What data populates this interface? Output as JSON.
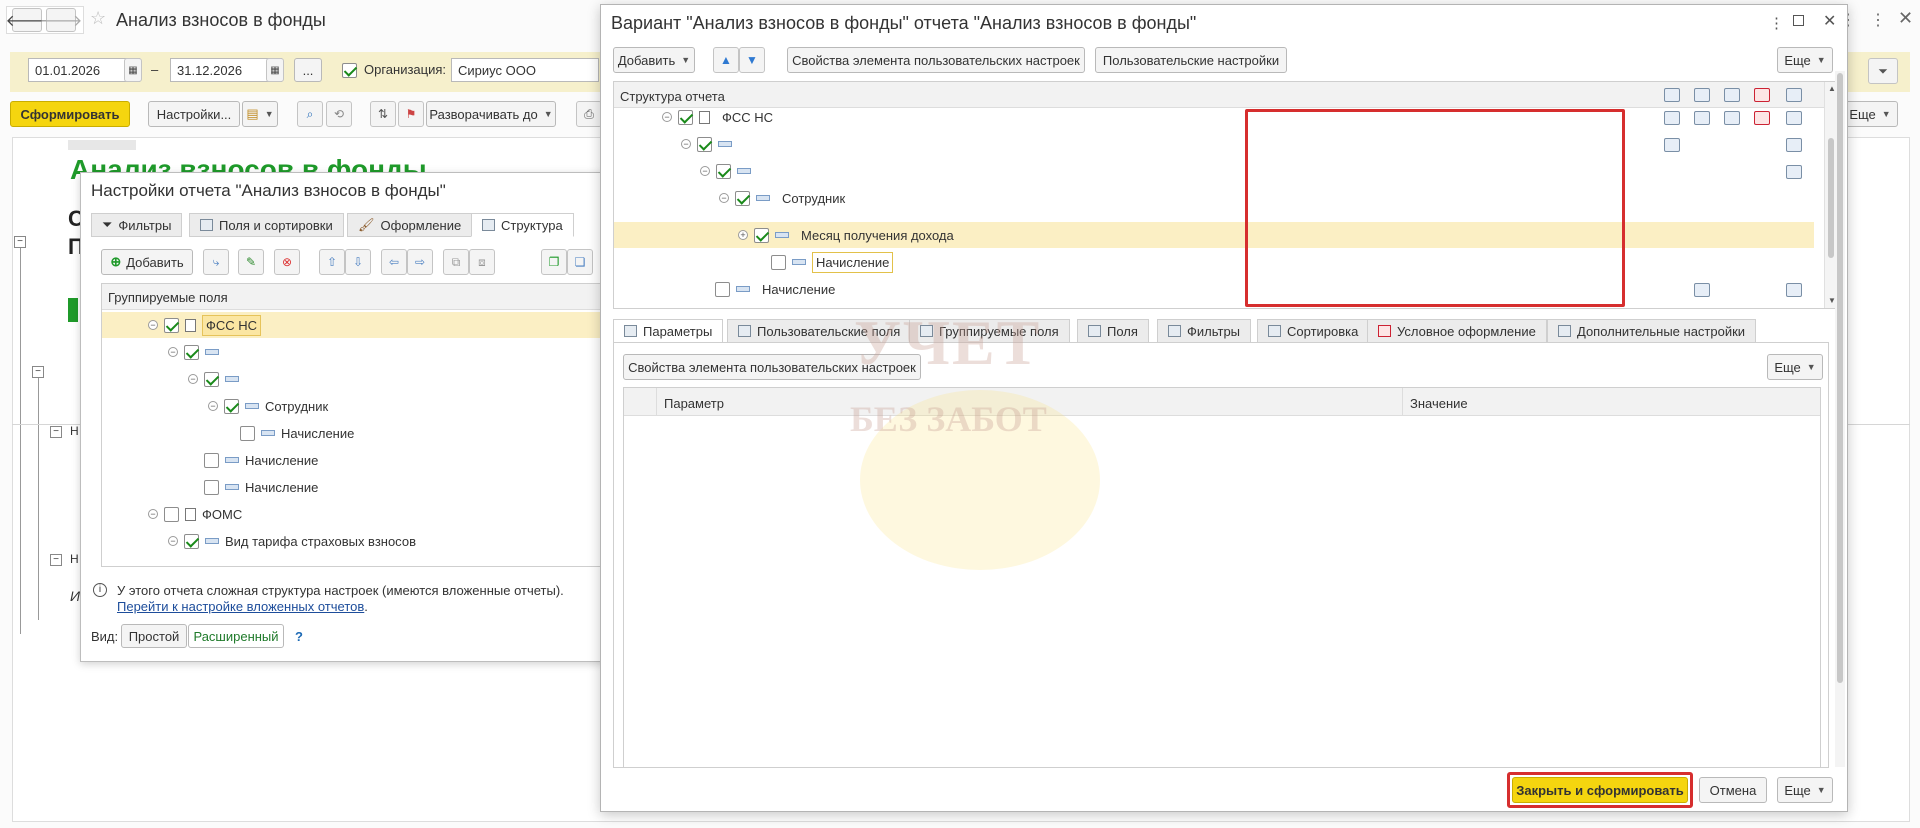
{
  "main": {
    "title": "Анализ взносов в фонды",
    "date_from": "01.01.2026",
    "date_dash": "–",
    "date_to": "31.12.2026",
    "ellipsis": "...",
    "org_label": "Организация:",
    "org_value": "Сириус ООО",
    "generate_btn": "Сформировать",
    "settings_btn": "Настройки...",
    "expand_btn": "Разворачивать до",
    "more_btn": "Еще",
    "report_title": "Анализ взносов в фонды",
    "frag_1": "С",
    "frag_2": "П",
    "frag_3": "Н",
    "frag_4": "Н",
    "frag_5": "И"
  },
  "settings_dialog": {
    "title": "Настройки отчета \"Анализ взносов в фонды\"",
    "tabs": [
      "Фильтры",
      "Поля и сортировки",
      "Оформление",
      "Структура"
    ],
    "add_btn": "Добавить",
    "grid_header": "Группируемые поля",
    "tree": [
      "ФСС НС",
      "Сотрудник",
      "Начисление",
      "Начисление",
      "Начисление",
      "ФОМС",
      "Вид тарифа страховых взносов"
    ],
    "info_text": "У этого отчета сложная структура настроек (имеются вложенные отчеты).",
    "info_link": "Перейти к настройке вложенных отчетов",
    "info_dot": ".",
    "view_label": "Вид:",
    "view_simple": "Простой",
    "view_extended": "Расширенный",
    "help": "?"
  },
  "variant_dialog": {
    "title": "Вариант \"Анализ взносов в фонды\" отчета \"Анализ взносов в фонды\"",
    "add_btn": "Добавить",
    "props_btn": "Свойства элемента пользовательских настроек",
    "user_settings_btn": "Пользовательские настройки",
    "more_btn": "Еще",
    "structure_header": "Структура отчета",
    "tree": [
      "ФСС НС",
      "Сотрудник",
      "Месяц получения дохода",
      "Начисление",
      "Начисление"
    ],
    "tabs": [
      "Параметры",
      "Пользовательские поля",
      "Группируемые поля",
      "Поля",
      "Фильтры",
      "Сортировка",
      "Условное оформление",
      "Дополнительные настройки"
    ],
    "props_btn2": "Свойства элемента пользовательских настроек",
    "more_btn2": "Еще",
    "col_param": "Параметр",
    "col_value": "Значение",
    "close_generate_btn": "Закрыть и сформировать",
    "cancel_btn": "Отмена",
    "more_btn3": "Еще"
  },
  "watermark": {
    "line1": "УЧЕТ",
    "line2": "БЕЗ ЗАБОТ"
  },
  "colors": {
    "accent_yellow": "#f5d50f",
    "highlight_red": "#d62e2e",
    "selected_row": "#fbefc4",
    "title_green": "#1f9a2a"
  }
}
